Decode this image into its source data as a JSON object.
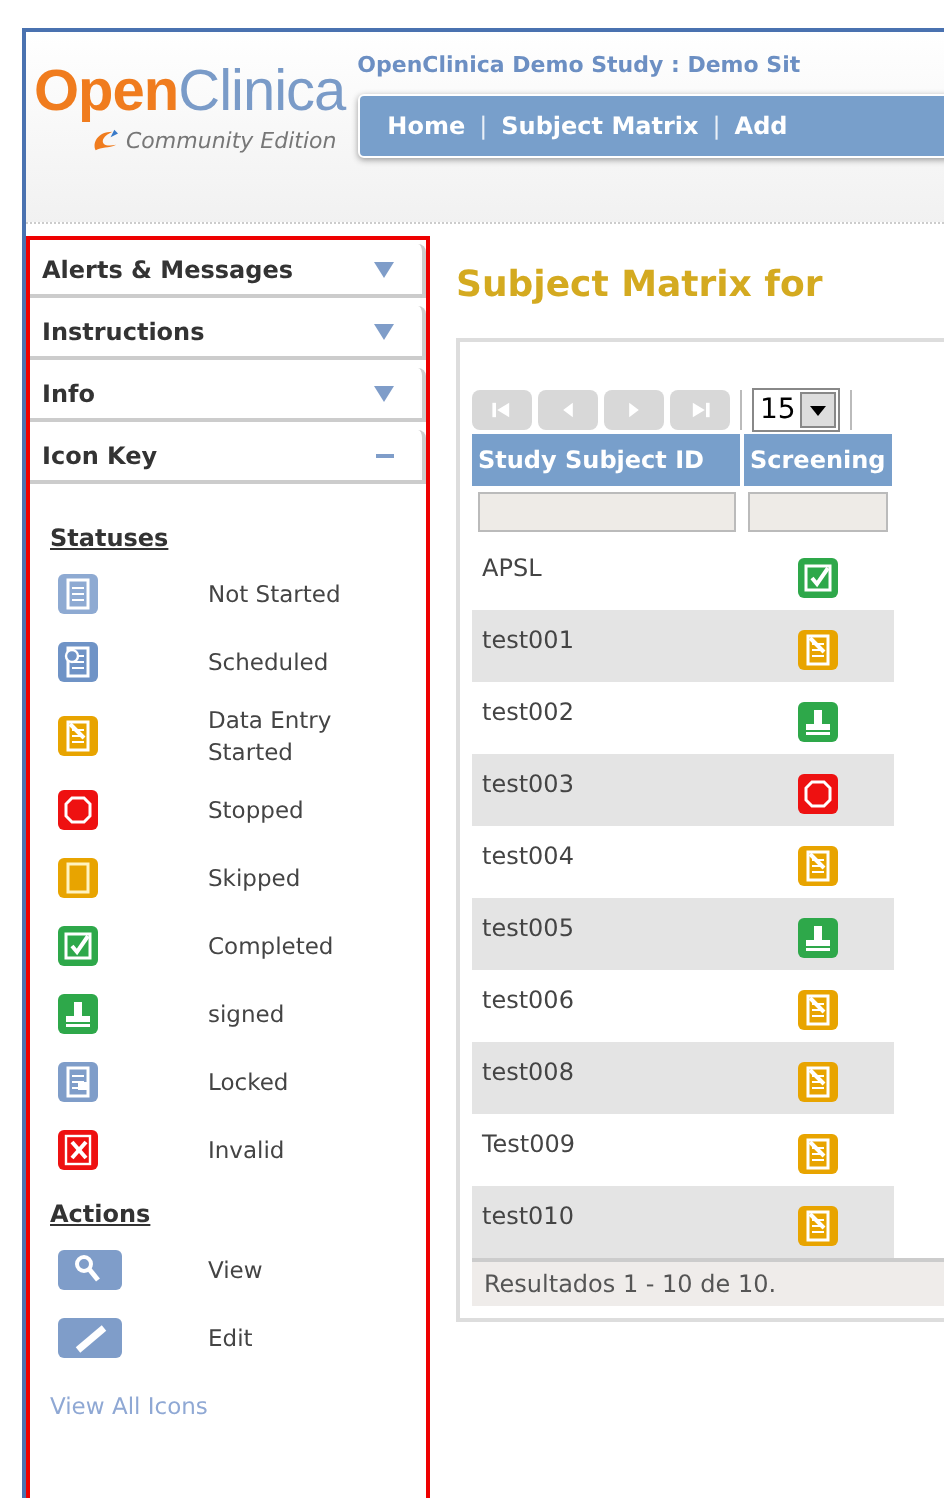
{
  "logo": {
    "wordmark_parts": [
      "Open",
      "Clinica"
    ],
    "edition": "Community Edition"
  },
  "header": {
    "study": "OpenClinica Demo Study : Demo Sit",
    "nav": [
      {
        "kind": "link",
        "label": "Home"
      },
      {
        "kind": "separator",
        "label": "|"
      },
      {
        "kind": "link",
        "label": "Subject Matrix"
      },
      {
        "kind": "separator",
        "label": "|"
      },
      {
        "kind": "link",
        "label": "Add"
      }
    ]
  },
  "sidebar": {
    "tabs": [
      {
        "label": "Alerts & Messages",
        "expanded": false
      },
      {
        "label": "Instructions",
        "expanded": false
      },
      {
        "label": "Info",
        "expanded": false
      },
      {
        "label": "Icon Key",
        "expanded": true
      }
    ],
    "icon_key": {
      "statuses_heading": "Statuses",
      "statuses": [
        {
          "kind": "not_started",
          "label": "Not Started"
        },
        {
          "kind": "scheduled",
          "label": "Scheduled"
        },
        {
          "kind": "data_entry_started",
          "label": "Data Entry Started"
        },
        {
          "kind": "stopped",
          "label": "Stopped"
        },
        {
          "kind": "skipped",
          "label": "Skipped"
        },
        {
          "kind": "completed",
          "label": "Completed"
        },
        {
          "kind": "signed",
          "label": "signed"
        },
        {
          "kind": "locked",
          "label": "Locked"
        },
        {
          "kind": "invalid",
          "label": "Invalid"
        }
      ],
      "actions_heading": "Actions",
      "actions": [
        {
          "kind": "view",
          "label": "View"
        },
        {
          "kind": "edit",
          "label": "Edit"
        }
      ],
      "link": "View All Icons"
    }
  },
  "main": {
    "title": "Subject Matrix for",
    "page_size": "15",
    "table": {
      "columns": [
        "Study Subject ID",
        "Screening"
      ],
      "rows": [
        {
          "id": "APSL",
          "kind": "completed"
        },
        {
          "id": "test001",
          "kind": "data_entry_started"
        },
        {
          "id": "test002",
          "kind": "signed"
        },
        {
          "id": "test003",
          "kind": "stopped"
        },
        {
          "id": "test004",
          "kind": "data_entry_started"
        },
        {
          "id": "test005",
          "kind": "signed"
        },
        {
          "id": "test006",
          "kind": "data_entry_started"
        },
        {
          "id": "test008",
          "kind": "data_entry_started"
        },
        {
          "id": "Test009",
          "kind": "data_entry_started"
        },
        {
          "id": "test010",
          "kind": "data_entry_started"
        }
      ],
      "footer": "Resultados 1 - 10 de 10."
    }
  }
}
